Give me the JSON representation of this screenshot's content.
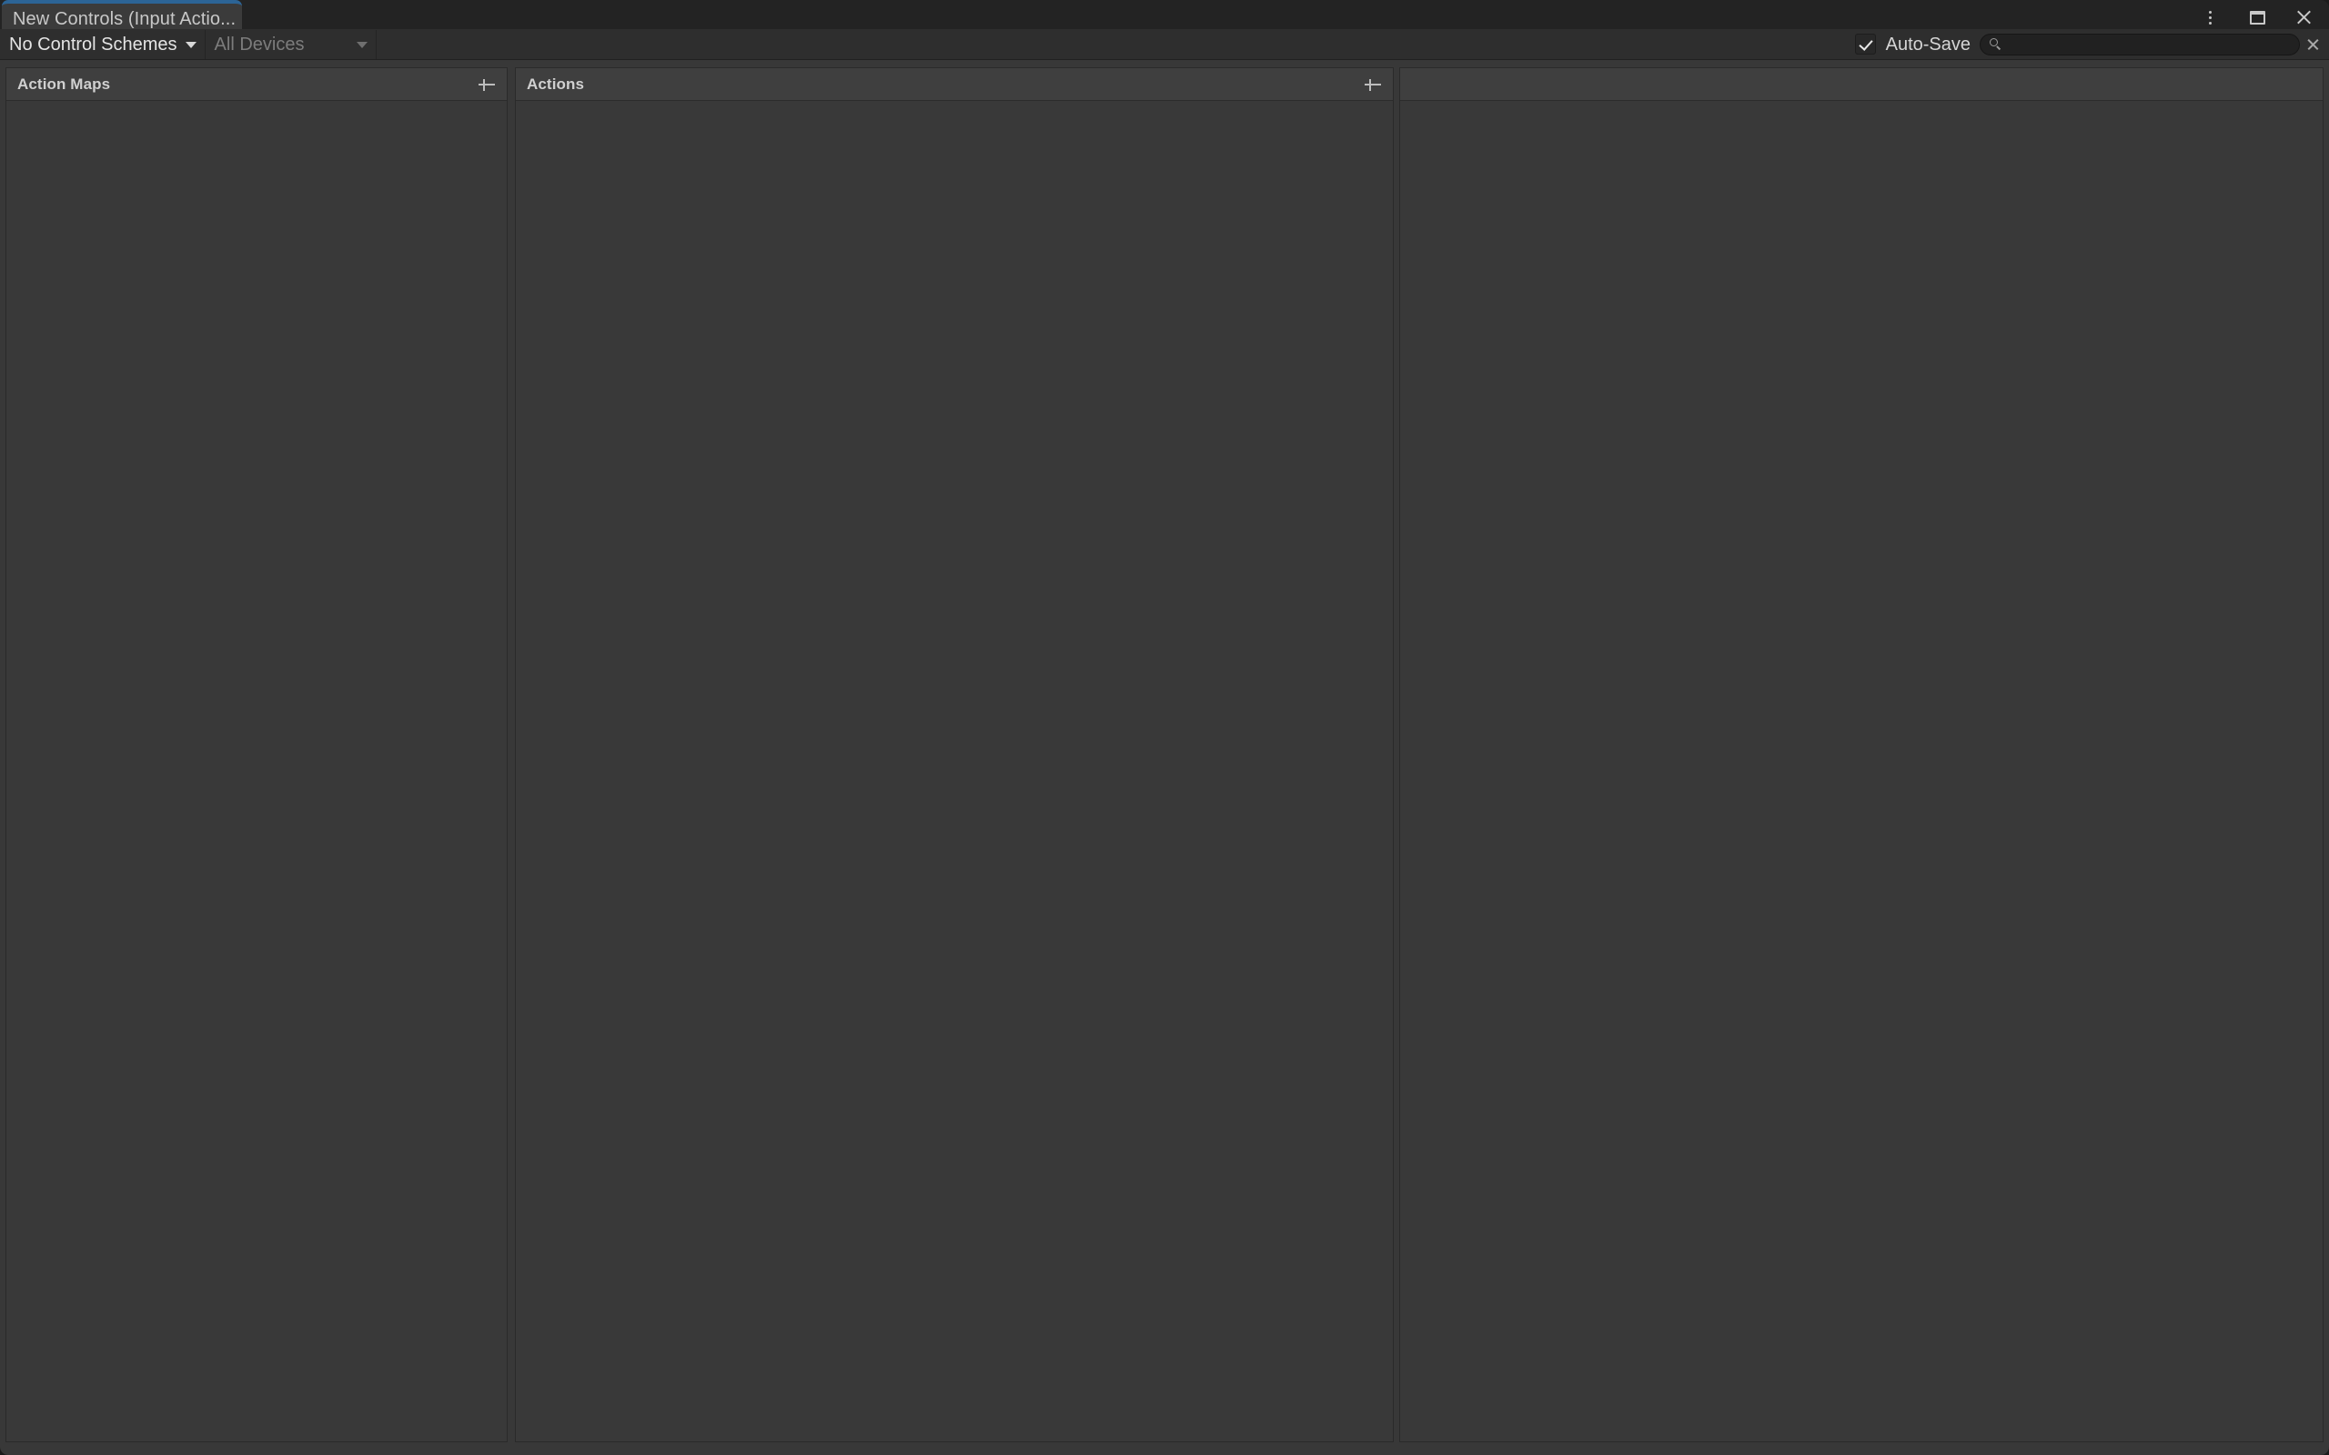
{
  "window": {
    "tab_label": "New Controls (Input Actio...",
    "accent_color": "#2c6496",
    "background_color": "#383838",
    "panel_background_color": "#393939",
    "header_background_color": "#3f3f3f",
    "controls": [
      {
        "name": "more-options",
        "icon": "kebab-icon",
        "glyph": "⋮"
      },
      {
        "name": "maximize",
        "icon": "maximize-icon",
        "glyph": "❐"
      },
      {
        "name": "close",
        "icon": "close-icon",
        "glyph": "✕"
      }
    ]
  },
  "toolbar": {
    "control_schemes_label": "No Control Schemes",
    "devices_label": "All Devices",
    "autosave_label": "Auto-Save",
    "autosave_checked": true,
    "search": {
      "value": "",
      "placeholder": "",
      "icon": "search-icon",
      "clear_icon": "close-icon"
    }
  },
  "panels": {
    "action_maps": {
      "title": "Action Maps",
      "add_label": "+",
      "items": []
    },
    "actions": {
      "title": "Actions",
      "add_label": "+",
      "items": []
    },
    "properties": {
      "title": "",
      "items": []
    }
  }
}
